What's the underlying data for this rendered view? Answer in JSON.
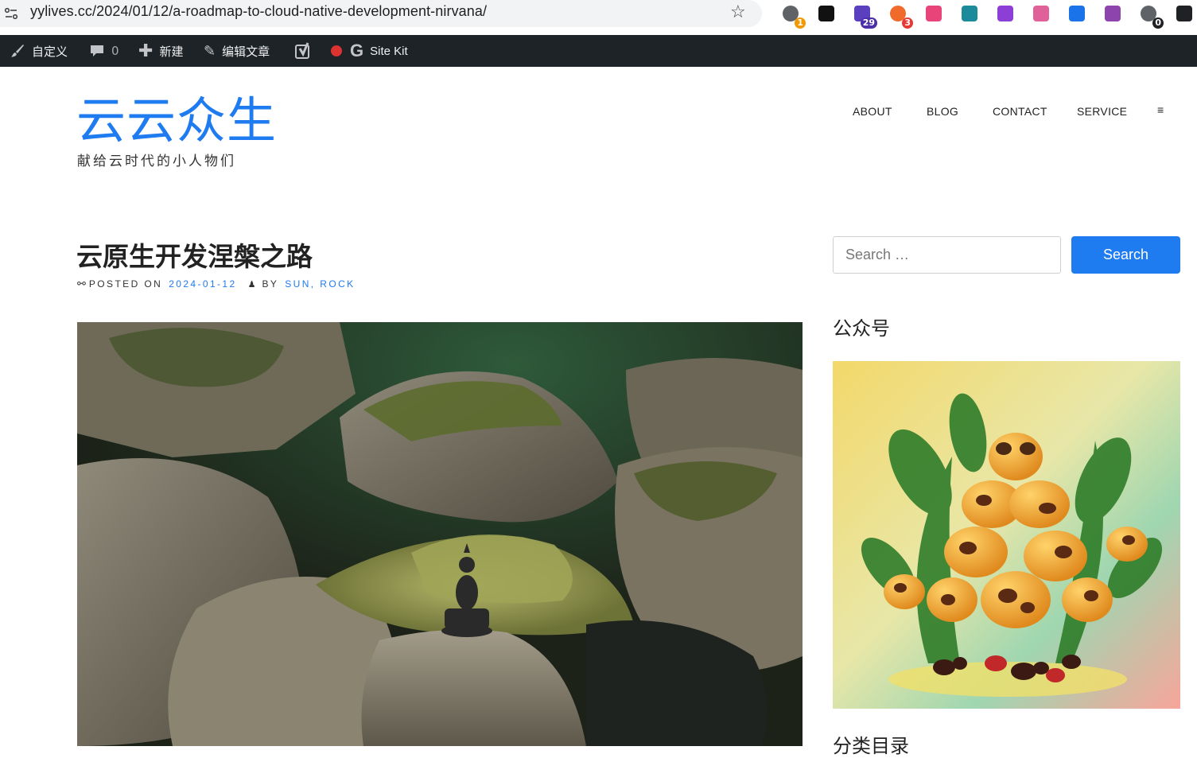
{
  "browser": {
    "url": "yylives.cc/2024/01/12/a-roadmap-to-cloud-native-development-nirvana/",
    "extensions": [
      {
        "name": "ext-ring-icon",
        "badge": "1",
        "color": "#5f6368",
        "badge_color": "#f29900"
      },
      {
        "name": "notion-icon",
        "badge": "",
        "color": "#111111",
        "badge_color": ""
      },
      {
        "name": "graduation-cap-icon",
        "badge": "29",
        "color": "#5a3fbf",
        "badge_color": "#4a2fa8"
      },
      {
        "name": "orange-dots-icon",
        "badge": "3",
        "color": "#f06a2b",
        "badge_color": "#e53935"
      },
      {
        "name": "translate-icon",
        "badge": "",
        "color": "#e8447a",
        "badge_color": ""
      },
      {
        "name": "grid-app-icon",
        "badge": "",
        "color": "#1b8a9a",
        "badge_color": ""
      },
      {
        "name": "lr-icon",
        "badge": "",
        "color": "#8c3fd6",
        "badge_color": ""
      },
      {
        "name": "cloud-pink-icon",
        "badge": "",
        "color": "#e0609a",
        "badge_color": ""
      },
      {
        "name": "blue-flag-icon",
        "badge": "",
        "color": "#1a73e8",
        "badge_color": ""
      },
      {
        "name": "openai-icon",
        "badge": "",
        "color": "#8e44ad",
        "badge_color": ""
      },
      {
        "name": "sync-icon",
        "badge": "0",
        "color": "#5f6368",
        "badge_color": "#202124"
      },
      {
        "name": "dark-square-icon",
        "badge": "",
        "color": "#202124",
        "badge_color": ""
      }
    ]
  },
  "adminbar": {
    "customize": "自定义",
    "comments_count": "0",
    "new_label": "新建",
    "edit_post": "编辑文章",
    "sitekit": "Site Kit"
  },
  "site": {
    "title": "云云众生",
    "description": "献给云时代的小人物们"
  },
  "nav": {
    "items": [
      "ABOUT",
      "BLOG",
      "CONTACT",
      "SERVICE"
    ],
    "menu_glyph": "≡"
  },
  "post": {
    "title": "云原生开发涅槃之路",
    "posted_on_label": "POSTED ON",
    "date": "2024-01-12",
    "by_label": "BY",
    "author": "SUN, ROCK"
  },
  "sidebar": {
    "search_placeholder": "Search …",
    "search_button": "Search",
    "wechat_title": "公众号",
    "categories_title": "分类目录"
  },
  "colors": {
    "accent": "#1e7bf0",
    "adminbar_bg": "#1d2327"
  }
}
